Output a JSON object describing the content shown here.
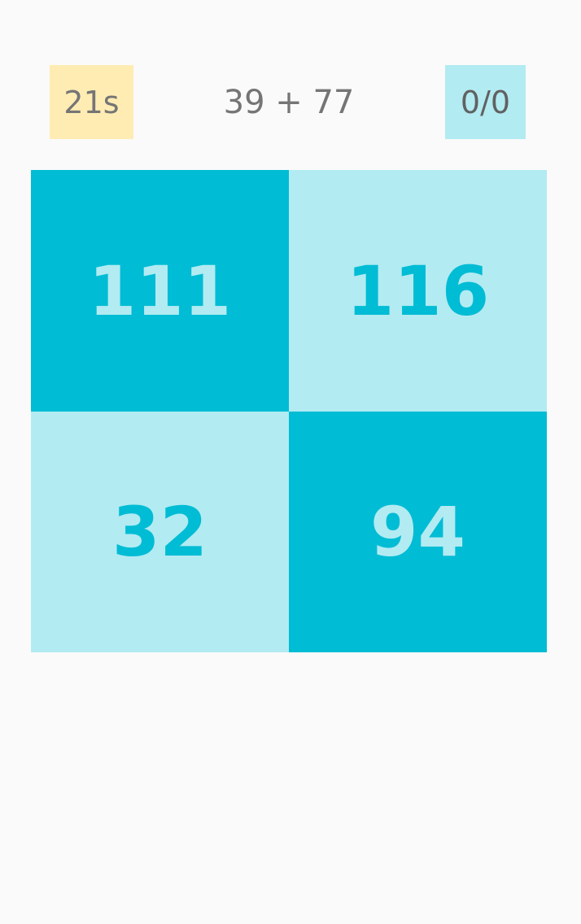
{
  "timer": {
    "label": "21s"
  },
  "question": {
    "text": "39 + 77"
  },
  "score": {
    "label": "0/0"
  },
  "answers": [
    {
      "value": "111",
      "style": "dark"
    },
    {
      "value": "116",
      "style": "light"
    },
    {
      "value": "32",
      "style": "light"
    },
    {
      "value": "94",
      "style": "dark"
    }
  ],
  "colors": {
    "background": "#fafafa",
    "accent": "#00bcd4",
    "accent_light": "#b2ebf2",
    "timer_bg": "#ffecb3",
    "text_gray": "#757575"
  }
}
